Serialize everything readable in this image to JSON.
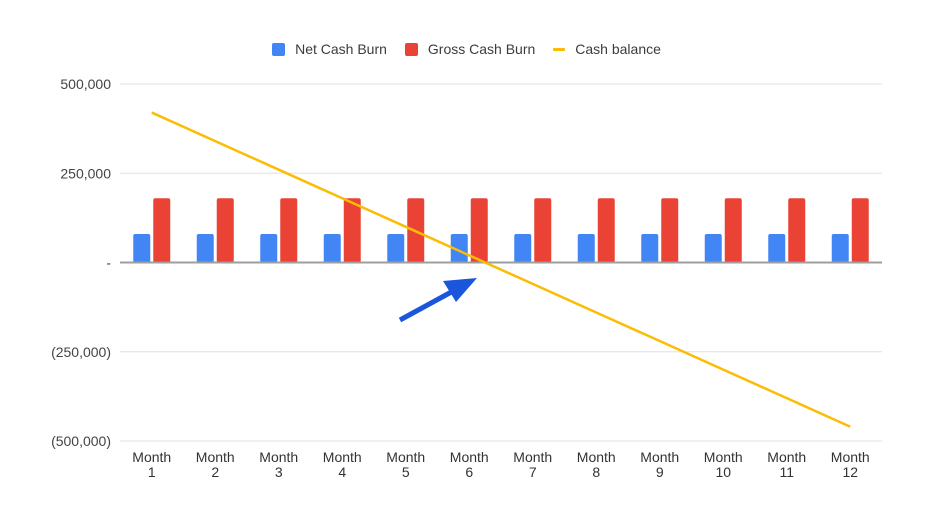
{
  "chart_data": {
    "type": "bar",
    "title": "",
    "xlabel": "",
    "ylabel": "",
    "categories": [
      "Month 1",
      "Month 2",
      "Month 3",
      "Month 4",
      "Month 5",
      "Month 6",
      "Month 7",
      "Month 8",
      "Month 9",
      "Month 10",
      "Month 11",
      "Month 12"
    ],
    "category_lines": [
      [
        "Month",
        "1"
      ],
      [
        "Month",
        "2"
      ],
      [
        "Month",
        "3"
      ],
      [
        "Month",
        "4"
      ],
      [
        "Month",
        "5"
      ],
      [
        "Month",
        "6"
      ],
      [
        "Month",
        "7"
      ],
      [
        "Month",
        "8"
      ],
      [
        "Month",
        "9"
      ],
      [
        "Month",
        "10"
      ],
      [
        "Month",
        "11"
      ],
      [
        "Month",
        "12"
      ]
    ],
    "series": [
      {
        "name": "Net Cash Burn",
        "type": "bar",
        "color": "#4285f4",
        "values": [
          80000,
          80000,
          80000,
          80000,
          80000,
          80000,
          80000,
          80000,
          80000,
          80000,
          80000,
          80000
        ]
      },
      {
        "name": "Gross Cash Burn",
        "type": "bar",
        "color": "#ea4335",
        "values": [
          180000,
          180000,
          180000,
          180000,
          180000,
          180000,
          180000,
          180000,
          180000,
          180000,
          180000,
          180000
        ]
      },
      {
        "name": "Cash balance",
        "type": "line",
        "color": "#fbbc04",
        "values": [
          420000,
          340000,
          260000,
          180000,
          100000,
          20000,
          -60000,
          -140000,
          -220000,
          -300000,
          -380000,
          -460000
        ]
      }
    ],
    "ylim": [
      -500000,
      500000
    ],
    "yticks": [
      500000,
      250000,
      0,
      -250000,
      -500000
    ],
    "ytick_labels": [
      "500,000",
      "250,000",
      "-",
      "(250,000)",
      "(500,000)"
    ],
    "grid": true,
    "legend_position": "top-center",
    "annotations": [
      {
        "type": "arrow",
        "color": "#1a56db",
        "points_to": "Cash balance crossing zero near Month 6"
      }
    ]
  }
}
